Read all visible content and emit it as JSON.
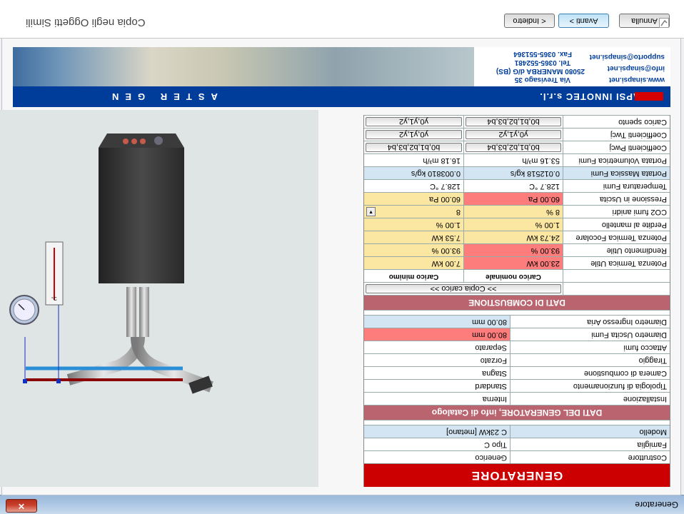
{
  "window": {
    "title": "Generatore",
    "close_symbol": "✕"
  },
  "wizard": {
    "title": "Copia negli Oggetti Simili",
    "back_label": "< Indietro",
    "next_label": "Avanti >",
    "cancel_label": "Annulla"
  },
  "header": {
    "company": "SINAPSI INNOTEC s.r.l.",
    "product": "ASTER GEN",
    "address_line1": "Via Trevisago 35",
    "address_line2": "25080 MANERBA d/G (BS)",
    "phone": "Tel. 0365-552481",
    "fax": "Fax. 0365-551364",
    "web": "www.sinapsi.net",
    "email_info": "info@sinapsi.net",
    "email_support": "supporto@sinapsi.net"
  },
  "table": {
    "banner": "GENERATORE",
    "info_rows": [
      {
        "label": "Costruttore",
        "value": "Generico"
      },
      {
        "label": "Famiglia",
        "value": "Tipo C"
      },
      {
        "label": "Modello",
        "value": "C 23kW [metano]"
      }
    ],
    "section_catalog": "DATI DEL GENERATORE, info di Catalogo",
    "catalog_rows": [
      {
        "label": "Installazione",
        "value": "Interna"
      },
      {
        "label": "Tipologia di funzionamento",
        "value": "Standard"
      },
      {
        "label": "Camera di combustione",
        "value": "Stagna"
      },
      {
        "label": "Tiraggio",
        "value": "Forzato"
      },
      {
        "label": "Attacco fumi",
        "value": "Separato"
      },
      {
        "label": "Diametro Uscita Fumi",
        "value": "80.00 mm"
      },
      {
        "label": "Diametro Ingresso Aria",
        "value": "80.00 mm"
      }
    ],
    "section_combustion": "DATI DI COMBUSTIONE",
    "copy_load_label": ">> Copia carico >>",
    "col_nominal": "Carico nominale",
    "col_minimum": "Carico minimo",
    "combustion_rows": [
      {
        "label": "Potenza Termica Utile",
        "nominal": "23.00 kW",
        "minimum": "7.00 kW"
      },
      {
        "label": "Rendimento Utile",
        "nominal": "93.00 %",
        "minimum": "93.00 %"
      },
      {
        "label": "Potenza Termica Focolare",
        "nominal": "24.73 kW",
        "minimum": "7.53 kW"
      },
      {
        "label": "Perdite al mantello",
        "nominal": "1.00 %",
        "minimum": "1.00 %"
      },
      {
        "label": "CO2 fumi anidri",
        "nominal": "8 %",
        "minimum": "8"
      },
      {
        "label": "Pressione in Uscita",
        "nominal": "60.00 Pa",
        "minimum": "60.00 Pa"
      },
      {
        "label": "Temperatura Fumi",
        "nominal": "128.7 °C",
        "minimum": "128.7 °C"
      },
      {
        "label": "Portata Massica Fumi",
        "nominal": "0.012518 kg/s",
        "minimum": "0.003810 kg/s"
      },
      {
        "label": "Portata Volumetrica Fumi",
        "nominal": "53.16 m³/h",
        "minimum": "16.18 m³/h"
      }
    ],
    "coef_rows": [
      {
        "label": "Coefficienti Pwcj",
        "nominal": "b0,b1,b2,b3,b4",
        "minimum": "b0,b1,b2,b3,b4"
      },
      {
        "label": "Coefficienti Twcj",
        "nominal": "y0,y1,y2",
        "minimum": "y0,y1,y2"
      },
      {
        "label": "Carico spento",
        "nominal": "b0,b1,b2,b3,b4",
        "minimum": "y0,y1,y2"
      }
    ]
  },
  "thermometer_unit": "°C"
}
